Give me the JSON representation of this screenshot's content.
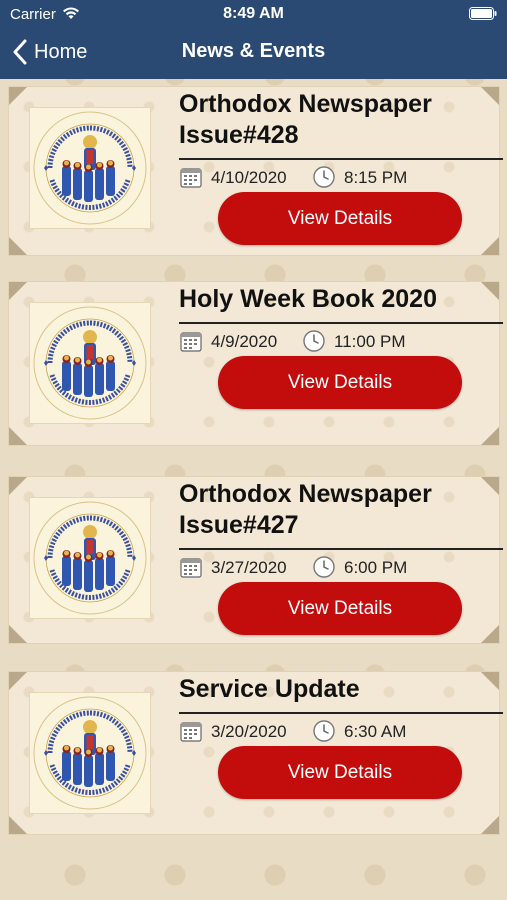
{
  "status_bar": {
    "carrier": "Carrier",
    "time": "8:49 AM"
  },
  "nav": {
    "back_label": "Home",
    "title": "News & Events"
  },
  "items": [
    {
      "title_line1": "Orthodox Newspaper",
      "title_line2": "Issue#428",
      "date": "4/10/2020",
      "time": "8:15 PM",
      "button": "View Details"
    },
    {
      "title_line1": "Holy Week Book 2020",
      "title_line2": "",
      "date": "4/9/2020",
      "time": "11:00 PM",
      "button": "View Details"
    },
    {
      "title_line1": "Orthodox Newspaper",
      "title_line2": "Issue#427",
      "date": "3/27/2020",
      "time": "6:00 PM",
      "button": "View Details"
    },
    {
      "title_line1": "Service Update",
      "title_line2": "",
      "date": "3/20/2020",
      "time": "6:30 AM",
      "button": "View Details"
    }
  ],
  "logo": {
    "text": "Diocese of Los Angeles, Southern California, and Hawaii · Saint Demiana Coptic Orthodox Church"
  },
  "colors": {
    "header": "#2a4a74",
    "button": "#c30d0d",
    "card": "#f3e8d6"
  }
}
